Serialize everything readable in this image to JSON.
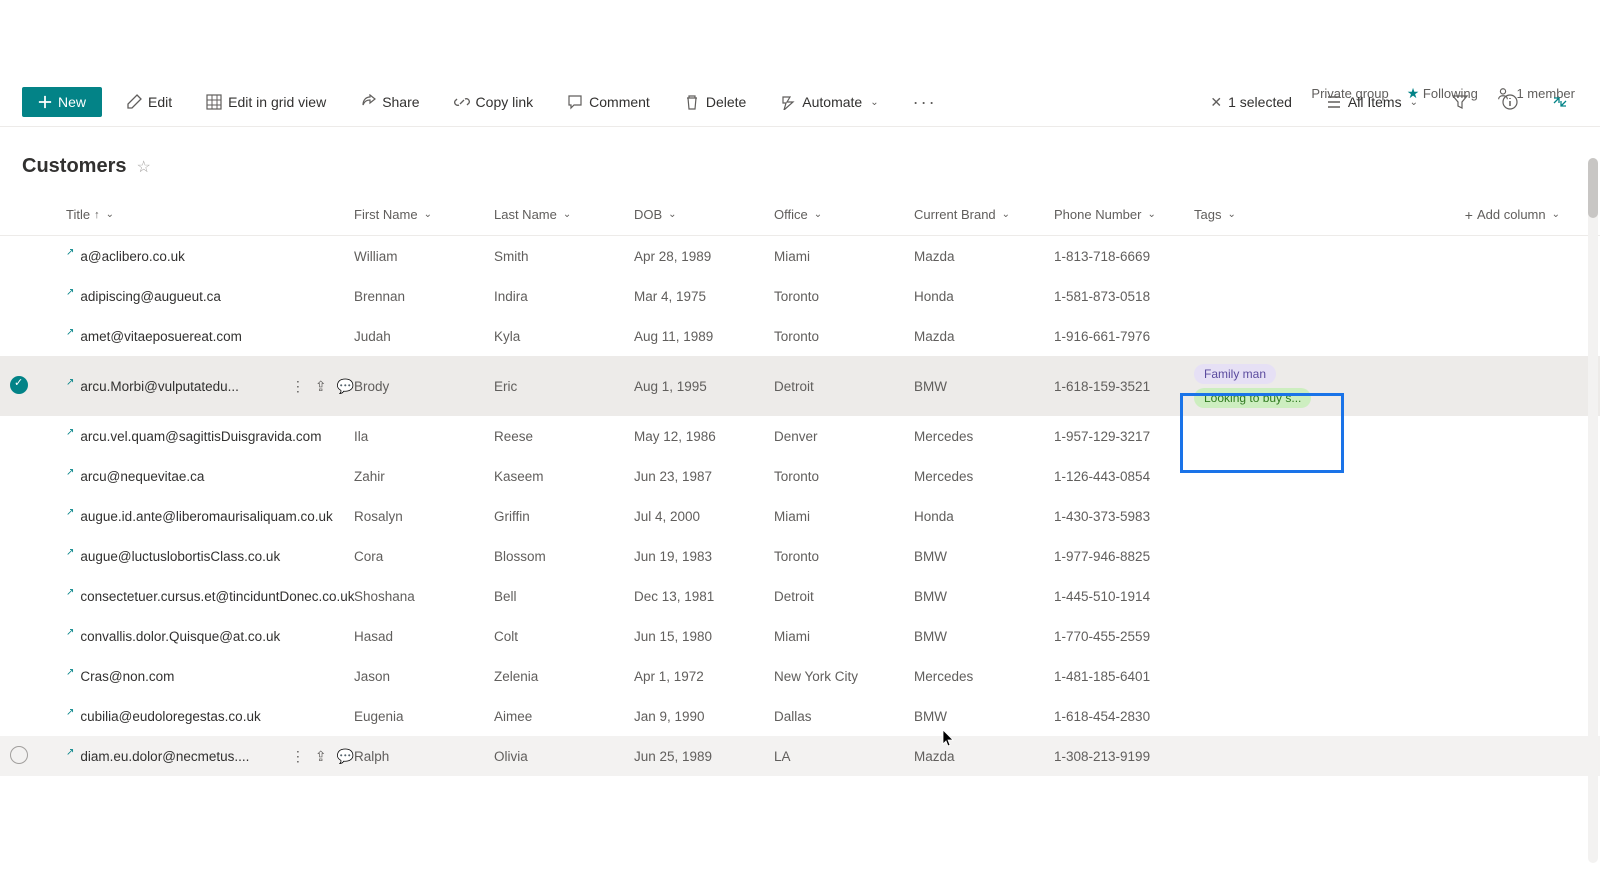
{
  "header": {
    "privacy": "Private group",
    "following_label": "Following",
    "members_label": "1 member"
  },
  "toolbar": {
    "new": "New",
    "edit": "Edit",
    "edit_grid": "Edit in grid view",
    "share": "Share",
    "copy_link": "Copy link",
    "comment": "Comment",
    "delete": "Delete",
    "automate": "Automate",
    "selected": "1 selected",
    "view": "All Items"
  },
  "list": {
    "title": "Customers",
    "columns": {
      "title": "Title",
      "first_name": "First Name",
      "last_name": "Last Name",
      "dob": "DOB",
      "office": "Office",
      "current_brand": "Current Brand",
      "phone": "Phone Number",
      "tags": "Tags",
      "add_column": "Add column"
    },
    "rows": [
      {
        "title": "a@aclibero.co.uk",
        "first": "William",
        "last": "Smith",
        "dob": "Apr 28, 1989",
        "office": "Miami",
        "brand": "Mazda",
        "phone": "1-813-718-6669",
        "tags": []
      },
      {
        "title": "adipiscing@augueut.ca",
        "first": "Brennan",
        "last": "Indira",
        "dob": "Mar 4, 1975",
        "office": "Toronto",
        "brand": "Honda",
        "phone": "1-581-873-0518",
        "tags": []
      },
      {
        "title": "amet@vitaeposuereat.com",
        "first": "Judah",
        "last": "Kyla",
        "dob": "Aug 11, 1989",
        "office": "Toronto",
        "brand": "Mazda",
        "phone": "1-916-661-7976",
        "tags": []
      },
      {
        "title": "arcu.Morbi@vulputatedu...",
        "first": "Brody",
        "last": "Eric",
        "dob": "Aug 1, 1995",
        "office": "Detroit",
        "brand": "BMW",
        "phone": "1-618-159-3521",
        "tags": [
          "Family man",
          "Looking to buy s..."
        ],
        "selected": true
      },
      {
        "title": "arcu.vel.quam@sagittisDuisgravida.com",
        "first": "Ila",
        "last": "Reese",
        "dob": "May 12, 1986",
        "office": "Denver",
        "brand": "Mercedes",
        "phone": "1-957-129-3217",
        "tags": []
      },
      {
        "title": "arcu@nequevitae.ca",
        "first": "Zahir",
        "last": "Kaseem",
        "dob": "Jun 23, 1987",
        "office": "Toronto",
        "brand": "Mercedes",
        "phone": "1-126-443-0854",
        "tags": []
      },
      {
        "title": "augue.id.ante@liberomaurisaliquam.co.uk",
        "first": "Rosalyn",
        "last": "Griffin",
        "dob": "Jul 4, 2000",
        "office": "Miami",
        "brand": "Honda",
        "phone": "1-430-373-5983",
        "tags": []
      },
      {
        "title": "augue@luctuslobortisClass.co.uk",
        "first": "Cora",
        "last": "Blossom",
        "dob": "Jun 19, 1983",
        "office": "Toronto",
        "brand": "BMW",
        "phone": "1-977-946-8825",
        "tags": []
      },
      {
        "title": "consectetuer.cursus.et@tinciduntDonec.co.uk",
        "first": "Shoshana",
        "last": "Bell",
        "dob": "Dec 13, 1981",
        "office": "Detroit",
        "brand": "BMW",
        "phone": "1-445-510-1914",
        "tags": []
      },
      {
        "title": "convallis.dolor.Quisque@at.co.uk",
        "first": "Hasad",
        "last": "Colt",
        "dob": "Jun 15, 1980",
        "office": "Miami",
        "brand": "BMW",
        "phone": "1-770-455-2559",
        "tags": []
      },
      {
        "title": "Cras@non.com",
        "first": "Jason",
        "last": "Zelenia",
        "dob": "Apr 1, 1972",
        "office": "New York City",
        "brand": "Mercedes",
        "phone": "1-481-185-6401",
        "tags": []
      },
      {
        "title": "cubilia@eudoloregestas.co.uk",
        "first": "Eugenia",
        "last": "Aimee",
        "dob": "Jan 9, 1990",
        "office": "Dallas",
        "brand": "BMW",
        "phone": "1-618-454-2830",
        "tags": []
      },
      {
        "title": "diam.eu.dolor@necmetus....",
        "first": "Ralph",
        "last": "Olivia",
        "dob": "Jun 25, 1989",
        "office": "LA",
        "brand": "Mazda",
        "phone": "1-308-213-9199",
        "tags": [],
        "hovered": true
      }
    ]
  }
}
